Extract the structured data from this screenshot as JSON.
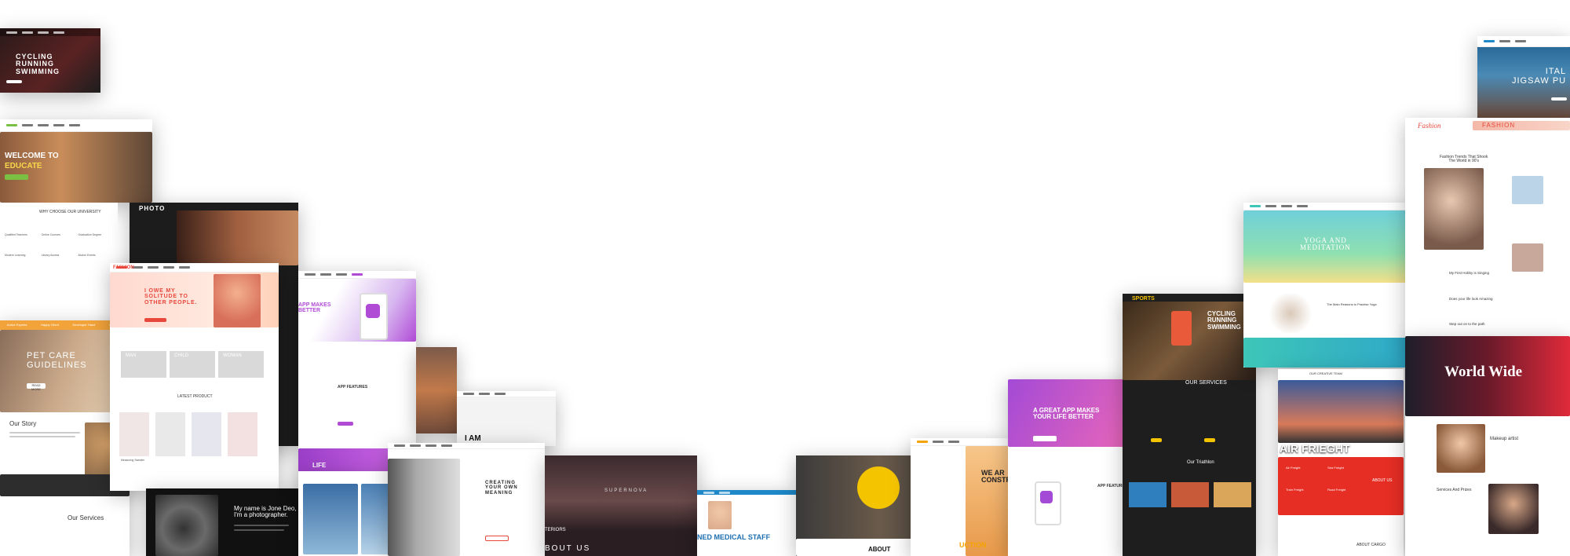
{
  "showcase": {
    "cycling_left": {
      "title": "CYCLING\nRUNNING\nSWIMMING"
    },
    "educate": {
      "welcome": "WELCOME TO",
      "brand": "EDUCATE",
      "why": "WHY CHOOSE OUR UNIVERSITY",
      "features": [
        "Qualified Teachers",
        "Online Courses",
        "Graduation Degree",
        "Modern Learning",
        "Library Access",
        "Alumni Events"
      ]
    },
    "pet": {
      "title": "PET CARE\nGUIDELINES",
      "story": "Our Story",
      "services": "Our Services",
      "btn": "READ MORE",
      "stats": [
        "Active Experts",
        "Happy Client",
        "Developer Hand",
        "Complete"
      ]
    },
    "photo": {
      "logo": "PHOTO"
    },
    "fashion_left": {
      "logo": "FASHION",
      "hero": "I OWE MY\nSOLITUDE TO\nOTHER PEOPLE.",
      "cats": [
        "MAN",
        "CHILD",
        "WOMAN"
      ],
      "latest": "LATEST PRODUCT",
      "product": "Measuring Sweater"
    },
    "photographer": {
      "intro": "My name is Jone Deo,\nI'm a photographer."
    },
    "app_left": {
      "headline": "APP MAKES\nBETTER",
      "features": "APP FEATURES",
      "life": "LIFE"
    },
    "paris": {
      "iam": "I AM"
    },
    "creating": {
      "title": "CREATING\nYOUR OWN\nMEANING"
    },
    "supernova": {
      "title": "SUPERNOVA",
      "about": "BOUT US",
      "interiors": "TERIORS"
    },
    "medical": {
      "title": "NED MEDICAL STAFF"
    },
    "barber": {
      "about": "ABOUT"
    },
    "construction": {
      "title": "WE AR\nCONSTRU",
      "bottom": "UCTION"
    },
    "app_right": {
      "headline": "A GREAT APP MAKES\nYOUR LIFE BETTER",
      "features": "APP FEATURES"
    },
    "sports": {
      "logo": "SPORTS",
      "title": "CYCLING\nRUNNING\nSWIMMING",
      "services": "OUR SERVICES",
      "triathlon": "Our Triathlon"
    },
    "yoga": {
      "title": "YOGA AND\nMEDITATION",
      "subtitle": "The Main Reasons to Practise Yoga"
    },
    "cargo": {
      "team": "OUR CREATIVE TEAM",
      "title": "AIR FRIEGHT",
      "about": "ABOUT US",
      "about_cargo": "ABOUT CARGO",
      "services": [
        "Air Freight",
        "Sea Freight",
        "Train Freight",
        "Road Freight"
      ]
    },
    "travel": {
      "title": "ITAL\nJIGSAW PU"
    },
    "fashion_right": {
      "logo": "Fashion",
      "banner": "FASHION",
      "headline": "Fashion Trends That Shook\nThe World in 90's",
      "posts": [
        "My First Hobby is Singing",
        "Does your life look Amazing",
        "Step out on to the path"
      ]
    },
    "world": {
      "title": "World Wide",
      "role": "Makeup artist",
      "services": "Services And Prizes"
    }
  },
  "colors": {
    "educate_green": "#7ac143",
    "pet_orange": "#f2a33a",
    "fashion_red": "#e8473b",
    "cargo_red": "#e62e24",
    "app_purple": "#b04bd6",
    "app_pink": "#ff6fb0",
    "yoga_teal": "#3ec6b8",
    "sports_yellow": "#f5c400",
    "world_red": "#b3122a"
  }
}
